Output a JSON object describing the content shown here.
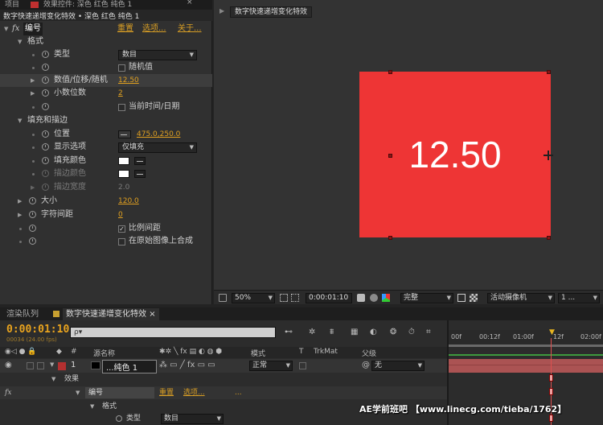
{
  "fx_panel": {
    "tab_left": "项目",
    "tab_label": "效果控件: 深色 红色 纯色 1",
    "subheader": "数字快速递增变化特效 • 深色 红色 纯色 1",
    "effect_name": "编号",
    "reset": "重置",
    "options": "选项...",
    "about": "关于...",
    "rows": {
      "format": "格式",
      "type_label": "类型",
      "type_value": "数目",
      "random_label": "随机值",
      "value_label": "数值/位移/随机",
      "value_value": "12.50",
      "decimals_label": "小数位数",
      "decimals_value": "2",
      "date_label": "当前时间/日期",
      "fill_stroke": "填充和描边",
      "position_label": "位置",
      "position_value": "475.0,250.0",
      "display_label": "显示选项",
      "display_value": "仅填充",
      "fill_color_label": "填充颜色",
      "stroke_color_label": "描边颜色",
      "stroke_width_label": "描边宽度",
      "stroke_width_value": "2.0",
      "size_label": "大小",
      "size_value": "120.0",
      "tracking_label": "字符间距",
      "tracking_value": "0",
      "proportional_label": "比例间距",
      "composite_label": "在原始图像上合成"
    },
    "fill_color": "#ffffff",
    "stroke_color": "#ffffff"
  },
  "comp": {
    "tab_label": "数字快速递增变化特效",
    "canvas_text": "12.50",
    "solid_color": "#ee3535",
    "toolbar": {
      "zoom": "50%",
      "timecode": "0:00:01:10",
      "resolution": "完整",
      "camera": "活动摄像机",
      "views": "1 ..."
    }
  },
  "timeline": {
    "tab_render": "渲染队列",
    "tab_comp": "数字快速递增变化特效",
    "timecode": "0:00:01:10",
    "fps": "00034 (24.00 fps)",
    "search_placeholder": "ρ▾",
    "ruler": [
      "00f",
      "00:12f",
      "01:00f",
      "12f",
      "02:00f"
    ],
    "columns": {
      "num": "#",
      "source": "源名称",
      "mode": "模式",
      "t": "T",
      "trkmat": "TrkMat",
      "parent": "父级"
    },
    "layer": {
      "num": "1",
      "name": "...纯色 1",
      "mode": "正常",
      "parent": "无",
      "color": "#b33030"
    },
    "sub_rows": {
      "effects": "效果",
      "effect_name": "编号",
      "reset": "重置",
      "options": "选项...",
      "ellipsis": "...",
      "format": "格式",
      "type_label": "类型",
      "type_value": "数目"
    }
  },
  "watermark": "AE学前班吧 【www.linecg.com/tieba/1762】"
}
